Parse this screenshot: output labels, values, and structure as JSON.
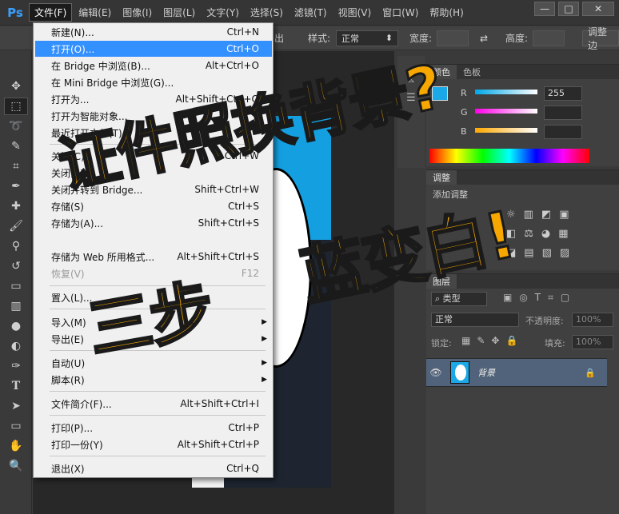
{
  "app": {
    "logo": "Ps"
  },
  "menubar": [
    "文件(F)",
    "编辑(E)",
    "图像(I)",
    "图层(L)",
    "文字(Y)",
    "选择(S)",
    "滤镜(T)",
    "视图(V)",
    "窗口(W)",
    "帮助(H)"
  ],
  "window_controls": {
    "minimize": "—",
    "restore": "□",
    "close": "✕"
  },
  "options": {
    "out_label": "出",
    "style_label": "样式:",
    "style_value": "正常",
    "width_label": "宽度:",
    "height_label": "高度:",
    "adjust_label": "调整边"
  },
  "file_menu": [
    {
      "label": "新建(N)...",
      "shortcut": "Ctrl+N"
    },
    {
      "label": "打开(O)...",
      "shortcut": "Ctrl+O",
      "highlighted": true
    },
    {
      "label": "在 Bridge 中浏览(B)...",
      "shortcut": "Alt+Ctrl+O"
    },
    {
      "label": "在 Mini Bridge 中浏览(G)...",
      "shortcut": ""
    },
    {
      "label": "打开为...",
      "shortcut": "Alt+Shift+Ctrl+O"
    },
    {
      "label": "打开为智能对象...",
      "shortcut": ""
    },
    {
      "label": "最近打开文件(T)",
      "shortcut": "",
      "submenu": true
    },
    {
      "label": "关闭(C)",
      "shortcut": "Ctrl+W"
    },
    {
      "label": "关闭全部",
      "shortcut": ""
    },
    {
      "label": "关闭并转到 Bridge...",
      "shortcut": "Shift+Ctrl+W"
    },
    {
      "label": "存储(S)",
      "shortcut": "Ctrl+S"
    },
    {
      "label": "存储为(A)...",
      "shortcut": "Shift+Ctrl+S"
    },
    {
      "label": "存储为 Web 所用格式...",
      "shortcut": "Alt+Shift+Ctrl+S"
    },
    {
      "label": "恢复(V)",
      "shortcut": "F12",
      "disabled": true
    },
    {
      "label": "置入(L)...",
      "shortcut": ""
    },
    {
      "label": "导入(M)",
      "shortcut": "",
      "submenu": true
    },
    {
      "label": "导出(E)",
      "shortcut": "",
      "submenu": true
    },
    {
      "label": "自动(U)",
      "shortcut": "",
      "submenu": true
    },
    {
      "label": "脚本(R)",
      "shortcut": "",
      "submenu": true
    },
    {
      "label": "文件简介(F)...",
      "shortcut": "Alt+Shift+Ctrl+I"
    },
    {
      "label": "打印(P)...",
      "shortcut": "Ctrl+P"
    },
    {
      "label": "打印一份(Y)",
      "shortcut": "Alt+Shift+Ctrl+P"
    },
    {
      "label": "退出(X)",
      "shortcut": "Ctrl+Q"
    }
  ],
  "color_panel": {
    "tabs": [
      "颜色",
      "色板"
    ],
    "r_label": "R",
    "g_label": "G",
    "b_label": "B",
    "r_value": "255",
    "fg_color": "#1aa8e8"
  },
  "adjust_panel": {
    "tab": "调整",
    "title": "添加调整"
  },
  "layers_panel": {
    "tab": "图层",
    "kind_label": "类型",
    "blend_mode": "正常",
    "opacity_label": "不透明度:",
    "opacity_value": "100%",
    "lock_label": "锁定:",
    "fill_label": "填充:",
    "fill_value": "100%",
    "layer_name": "背景"
  },
  "overlay": {
    "line1": "证件照换背景?",
    "line2a": "三步",
    "line2b": "蓝变白!"
  },
  "colors": {
    "accent": "#3390ff",
    "overlay_text": "#f6a800",
    "photo_bg": "#14a0e0"
  }
}
